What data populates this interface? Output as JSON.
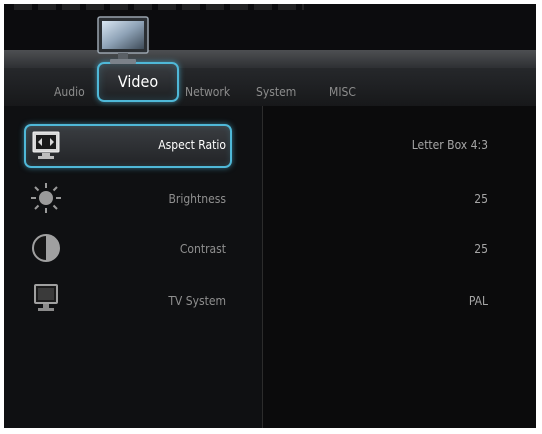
{
  "tabs": [
    {
      "label": "Audio",
      "active": false
    },
    {
      "label": "Video",
      "active": true
    },
    {
      "label": "Network",
      "active": false
    },
    {
      "label": "System",
      "active": false
    },
    {
      "label": "MISC",
      "active": false
    }
  ],
  "settings": [
    {
      "label": "Aspect Ratio",
      "value": "Letter Box 4:3",
      "icon": "aspect-ratio-icon",
      "selected": true
    },
    {
      "label": "Brightness",
      "value": "25",
      "icon": "brightness-icon",
      "selected": false
    },
    {
      "label": "Contrast",
      "value": "25",
      "icon": "contrast-icon",
      "selected": false
    },
    {
      "label": "TV System",
      "value": "PAL",
      "icon": "tv-system-icon",
      "selected": false
    }
  ],
  "colors": {
    "accent": "#4fb8d8",
    "background": "#0c0c0e",
    "text": "#8f8f8f"
  }
}
